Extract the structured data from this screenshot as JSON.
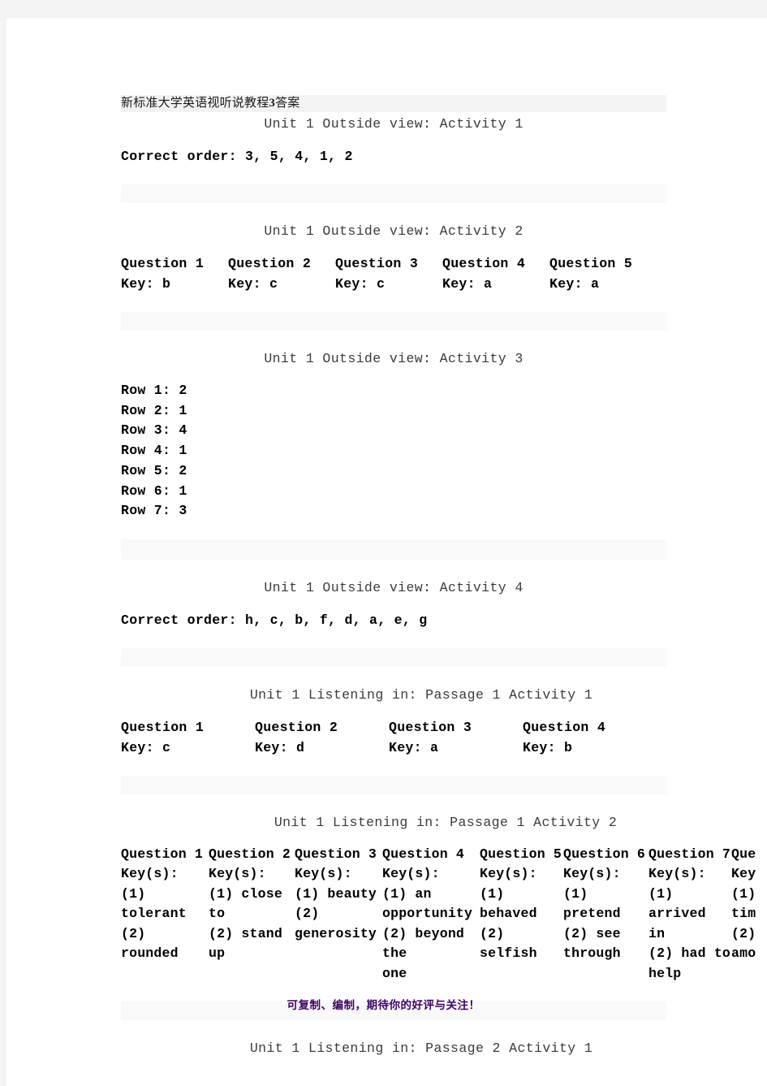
{
  "document": {
    "title_cn": "新标准大学英语视听说教程",
    "title_num": "3",
    "title_suffix": "答案",
    "footer_note": "可复制、编制，期待你的好评与关注！",
    "footer_color": "#3c0463"
  },
  "sections": [
    {
      "id": "u1-ov-a1",
      "heading": "Unit 1 Outside view: Activity 1",
      "body_label": "Correct order:",
      "body_value": "3, 5, 4, 1, 2",
      "body_line": "Correct order: 3, 5, 4, 1, 2"
    },
    {
      "id": "u1-ov-a2",
      "heading": "Unit 1 Outside view: Activity 2",
      "questions": [
        {
          "question": "Question 1",
          "key": "Key: b"
        },
        {
          "question": "Question 2",
          "key": "Key: c"
        },
        {
          "question": "Question 3",
          "key": "Key: c"
        },
        {
          "question": "Question 4",
          "key": "Key: a"
        },
        {
          "question": "Question 5",
          "key": "Key: a"
        }
      ]
    },
    {
      "id": "u1-ov-a3",
      "heading": "Unit 1 Outside view: Activity 3",
      "rows": [
        "Row 1: 2",
        "Row 2: 1",
        "Row 3: 4",
        "Row 4: 1",
        "Row 5: 2",
        "Row 6: 1",
        "Row 7: 3"
      ]
    },
    {
      "id": "u1-ov-a4",
      "heading": "Unit 1 Outside view: Activity 4",
      "body_line": "Correct order: h, c, b, f, d, a, e, g"
    },
    {
      "id": "u1-li-p1-a1",
      "heading": "Unit 1 Listening in: Passage 1 Activity 1",
      "questions": [
        {
          "question": "Question 1",
          "key": "Key: c"
        },
        {
          "question": "Question 2",
          "key": "Key: d"
        },
        {
          "question": "Question 3",
          "key": "Key: a"
        },
        {
          "question": "Question 4",
          "key": "Key: b"
        }
      ]
    },
    {
      "id": "u1-li-p1-a2",
      "heading": "Unit 1 Listening in: Passage 1 Activity 2",
      "key_columns": [
        {
          "question": "Question 1",
          "keys_label": "Key(s):",
          "lines": [
            "(1)",
            "tolerant",
            "(2)",
            "rounded"
          ]
        },
        {
          "question": "Question 2",
          "keys_label": "Key(s):",
          "lines": [
            "(1) close",
            "to",
            "(2) stand",
            "up"
          ]
        },
        {
          "question": "Question 3",
          "keys_label": "Key(s):",
          "lines": [
            "(1) beauty",
            "(2)",
            "generosity",
            ""
          ]
        },
        {
          "question": "Question 4",
          "keys_label": "Key(s):",
          "lines": [
            "(1) an",
            "opportunity",
            "(2) beyond the",
            "one"
          ]
        },
        {
          "question": "Question 5",
          "keys_label": "Key(s):",
          "lines": [
            "(1)",
            "behaved",
            "(2)",
            "selfish"
          ]
        },
        {
          "question": "Question 6",
          "keys_label": "Key(s):",
          "lines": [
            "(1) pretend",
            "(2) see",
            "through",
            ""
          ]
        },
        {
          "question": "Question 7",
          "keys_label": "Key(s):",
          "lines": [
            "(1) arrived",
            "in",
            "(2) had to",
            "help"
          ]
        },
        {
          "question": "Que",
          "keys_label": "Key",
          "lines": [
            "(1)",
            "tim",
            "(2)",
            "amo"
          ]
        }
      ]
    },
    {
      "id": "u1-li-p2-a1",
      "heading": "Unit 1 Listening in: Passage 2 Activity 1"
    }
  ]
}
